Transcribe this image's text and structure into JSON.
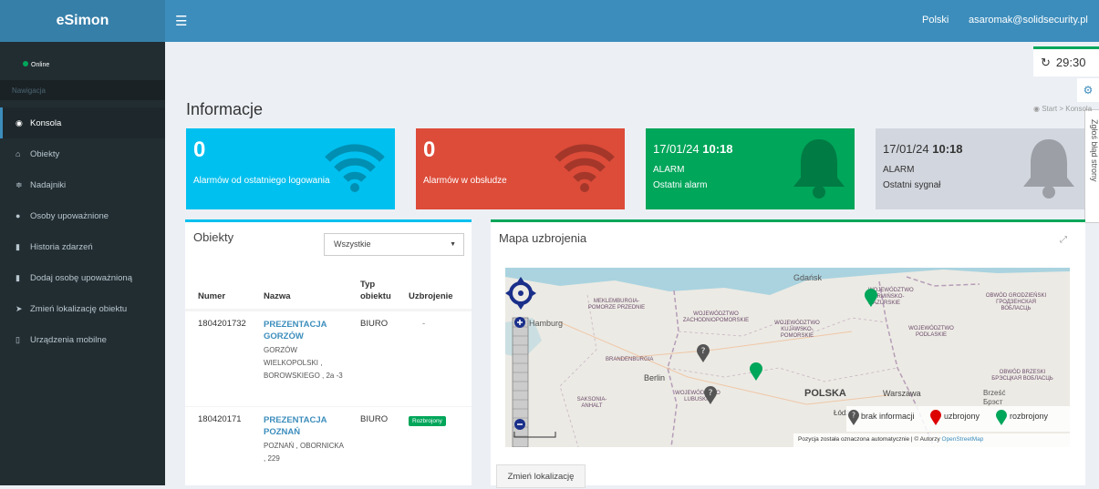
{
  "header": {
    "logo": "eSimon",
    "language": "Polski",
    "user_email": "asaromak@solidsecurity.pl"
  },
  "sidebar": {
    "status": "Online",
    "section": "Nawigacja",
    "items": [
      {
        "label": "Konsola",
        "icon": "dashboard-icon",
        "active": true
      },
      {
        "label": "Obiekty",
        "icon": "home-icon"
      },
      {
        "label": "Nadajniki",
        "icon": "rss-icon"
      },
      {
        "label": "Osoby upoważnione",
        "icon": "users-icon"
      },
      {
        "label": "Historia zdarzeń",
        "icon": "book-icon"
      },
      {
        "label": "Dodaj osobę upoważnioną",
        "icon": "book-icon"
      },
      {
        "label": "Zmień lokalizację obiektu",
        "icon": "location-arrow-icon"
      },
      {
        "label": "Urządzenia mobilne",
        "icon": "mobile-icon"
      }
    ]
  },
  "timer": {
    "value": "29:30"
  },
  "report_tab": "Zgłoś błąd strony",
  "page": {
    "title": "Informacje",
    "breadcrumb_start": "Start",
    "breadcrumb_current": "Konsola"
  },
  "info_boxes": [
    {
      "value": "0",
      "label": "Alarmów od ostatniego logowania",
      "color": "#00c0ef",
      "icon": "wifi-icon"
    },
    {
      "value": "0",
      "label": "Alarmów w obsłudze",
      "color": "#dd4b39",
      "icon": "wifi-icon"
    },
    {
      "date": "17/01/24",
      "time": "10:18",
      "line1": "ALARM",
      "line2": "Ostatni alarm",
      "color": "#00a65a",
      "icon": "bell-icon"
    },
    {
      "date": "17/01/24",
      "time": "10:18",
      "line1": "ALARM",
      "line2": "Ostatni sygnał",
      "color": "#d2d6de",
      "icon": "bell-icon"
    }
  ],
  "objects_panel": {
    "title": "Obiekty",
    "filter_value": "Wszystkie",
    "columns": [
      "Numer",
      "Nazwa",
      "Typ obiektu",
      "Uzbrojenie"
    ],
    "rows": [
      {
        "number": "1804201732",
        "name": "PREZENTACJA GORZÓW",
        "address": "GORZÓW WIELKOPOLSKI , BOROWSKIEGO , 2a -3",
        "type": "BIURO",
        "armed": "-",
        "armed_badge": ""
      },
      {
        "number": "180420171",
        "name": "PREZENTACJA POZNAŃ",
        "address": "POZNAŃ , OBORNICKA , 229",
        "type": "BIURO",
        "armed": "",
        "armed_badge": "Rozbrojony"
      }
    ]
  },
  "map_panel": {
    "title": "Mapa uzbrojenia",
    "labels": {
      "gdansk": "Gdańsk",
      "warminsko": "WOJEWÓDZTWO WARMIŃSKO-MAZURSKIE",
      "grodzienski": "OBWÓD GRODZIEŃSKI ГРОДЗЕНСКАЯ ВОБЛАСЦЬ",
      "meklemburgia": "MEKLEMBURGIA-POMORZE PRZEDNIE",
      "zachodnio": "WOJEWÓDZTWO ZACHODNIOPOMORSKIE",
      "kujawsko": "WOJEWÓDZTWO KUJAWSKO-POMORSKIE",
      "podlaskie": "WOJEWÓDZTWO PODLASKIE",
      "brandenburgia": "BRANDENBURGIA",
      "berlin": "Berlin",
      "lubuskie": "WOJEWÓDZTWO LUBUSKIE",
      "polska": "POLSKA",
      "warszawa": "Warszawa",
      "brzeski": "OBWÓD BRZESKI БРЭСЦКАЯ ВОБЛАСЦЬ",
      "brzesc": "Brześć Брэст",
      "saksonia": "SAKSONIA-ANHALT",
      "hamburg": "Hamburg",
      "lodz": "Łódź"
    },
    "legend": {
      "none": "brak informacji",
      "armed": "uzbrojony",
      "disarmed": "rozbrojony"
    },
    "attribution": "Pozycja została oznaczona automatycznie | © Autorzy",
    "attribution_link": "OpenStreetMap",
    "change_button": "Zmień lokalizację"
  },
  "colors": {
    "header": "#3c8dbc",
    "sidebar": "#222d32",
    "marker_green": "#00a65a",
    "marker_red": "#dd0000",
    "marker_grey": "#555555"
  }
}
